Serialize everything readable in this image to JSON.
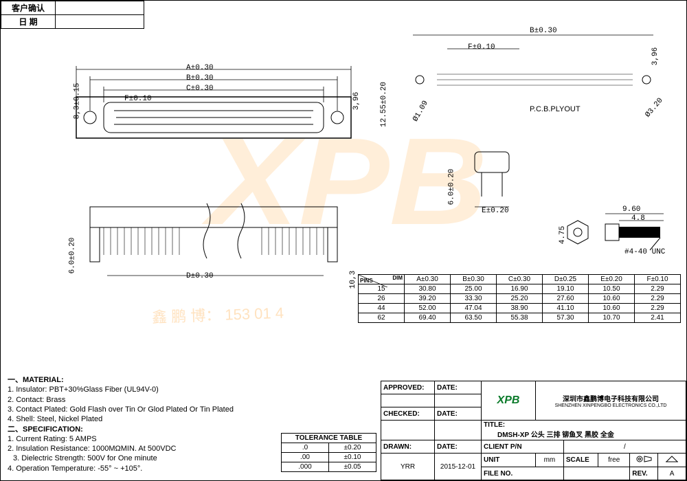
{
  "header": {
    "customer_confirm_label": "客户确认",
    "date_label": "日 期"
  },
  "dims_labels": {
    "A": "A±0.30",
    "B": "B±0.30",
    "C": "C±0.30",
    "D": "D±0.30",
    "F": "F±0.10",
    "h83": "8,3±0.15",
    "h396": "3,96",
    "h1255": "12.55±0.20",
    "d109": "Ø1.09",
    "pcb": "P.C.B.PLYOUT",
    "d320": "Ø3.20",
    "B2": "B±0.30",
    "F2": "F±0.10",
    "h396b": "3,96",
    "E": "E±0.20",
    "h60": "6.0±0.20",
    "h60b": "6.0±0.20",
    "h103": "10,3",
    "h475": "4.75",
    "h960": "9.60",
    "h48": "4.8",
    "thread": "#4-40 UNC"
  },
  "chart_data": {
    "type": "table",
    "title": "Dimension table",
    "columns": [
      "PINS",
      "A±0.30",
      "B±0.30",
      "C±0.30",
      "D±0.25",
      "E±0.20",
      "F±0.10"
    ],
    "rows": [
      {
        "pins": "15",
        "A": "30.80",
        "B": "25.00",
        "C": "16.90",
        "D": "19.10",
        "E": "10.50",
        "F": "2.29"
      },
      {
        "pins": "26",
        "A": "39.20",
        "B": "33.30",
        "C": "25.20",
        "D": "27.60",
        "E": "10.60",
        "F": "2.29"
      },
      {
        "pins": "44",
        "A": "52.00",
        "B": "47.04",
        "C": "38.90",
        "D": "41.10",
        "E": "10.60",
        "F": "2.29"
      },
      {
        "pins": "62",
        "A": "69.40",
        "B": "63.50",
        "C": "55.38",
        "D": "57.30",
        "E": "10.70",
        "F": "2.41"
      }
    ],
    "dim_corner": "DIM"
  },
  "notes": {
    "mat_hdr": "一、MATERIAL:",
    "m1": "1. Insulator: PBT+30%Glass Fiber (UL94V-0)",
    "m2": "2. Contact: Brass",
    "m3": "3. Contact Plated: Gold Flash over Tin Or Glod Plated Or Tin Plated",
    "m4": "4. Shell: Steel, Nickel Plated",
    "spec_hdr": "二、SPECIFICATION:",
    "s1": "1. Current Rating: 5 AMPS",
    "s2": "2. Insulation Resistance: 1000MΩMIN. At 500VDC",
    "s3": "3. Dielectric Strength: 500V for One minute",
    "s4": "4. Operation Temperature: -55° ~ +105°."
  },
  "tolerance": {
    "caption": "TOLERANCE TABLE",
    "rows": [
      {
        "p": ".0",
        "t": "±0.20"
      },
      {
        "p": ".00",
        "t": "±0.10"
      },
      {
        "p": ".000",
        "t": "±0.05"
      }
    ]
  },
  "title_block": {
    "approved_l": "APPROVED:",
    "approved_v": "",
    "checked_l": "CHECKED:",
    "checked_v": "",
    "drawn_l": "DRAWN:",
    "drawn_v": "YRR",
    "date_l": "DATE:",
    "date1": "",
    "date2": "",
    "date3": "2015-12-01",
    "company_cn": "深圳市鑫鹏博电子科技有限公司",
    "company_en": "SHENZHEN XINPENGBO ELECTRONICS CO.,LTD",
    "logo": "XPB",
    "title_l": "TITLE:",
    "title_v": "DMSH-XP 公头 三排 铆鱼叉 黑胶 全金",
    "client_l": "CLIENT P/N",
    "client_v": "/",
    "unit_l": "UNIT",
    "unit_v": "mm",
    "scale_l": "SCALE",
    "scale_v": "free",
    "proj": "⊕",
    "ang": "⬚",
    "file_l": "FILE NO.",
    "file_v": "",
    "rev_l": "REV.",
    "rev_v": "A"
  },
  "watermark": "XPB",
  "watermark2": "鑫 鹏 博：   153 01   4"
}
